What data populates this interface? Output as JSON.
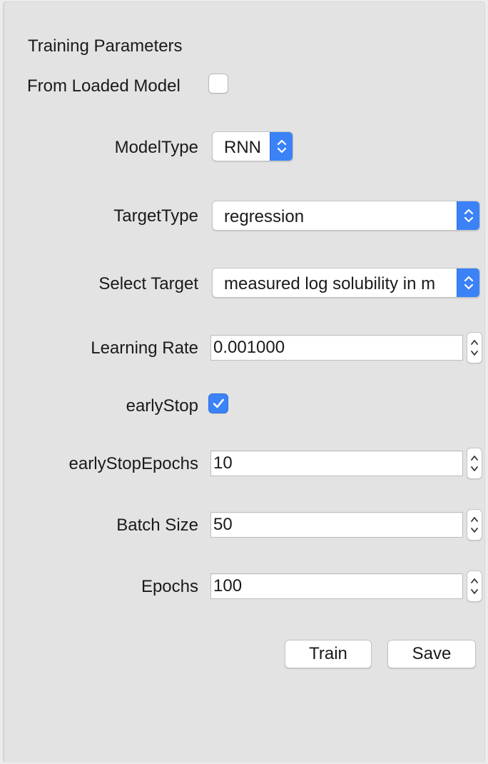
{
  "panel": {
    "title": "Training Parameters"
  },
  "from_loaded_model": {
    "label": "From Loaded Model",
    "checked": false
  },
  "model_type": {
    "label": "ModelType",
    "selected": "RNN"
  },
  "target_type": {
    "label": "TargetType",
    "selected": "regression"
  },
  "select_target": {
    "label": "Select Target",
    "selected": "measured log solubility in m"
  },
  "learning_rate": {
    "label": "Learning Rate",
    "value": "0.001000"
  },
  "early_stop": {
    "label": "earlyStop",
    "checked": true
  },
  "early_stop_epochs": {
    "label": "earlyStopEpochs",
    "value": "10"
  },
  "batch_size": {
    "label": "Batch Size",
    "value": "50"
  },
  "epochs": {
    "label": "Epochs",
    "value": "100"
  },
  "buttons": {
    "train_label": "Train",
    "save_label": "Save"
  },
  "colors": {
    "accent": "#3b82f7",
    "panel_bg": "#e3e3e3",
    "field_bg": "#ffffff"
  },
  "icons": {
    "popup_arrows": "chevron-up-down-icon",
    "stepper": "stepper-arrows-icon",
    "checkmark": "checkmark-icon"
  }
}
